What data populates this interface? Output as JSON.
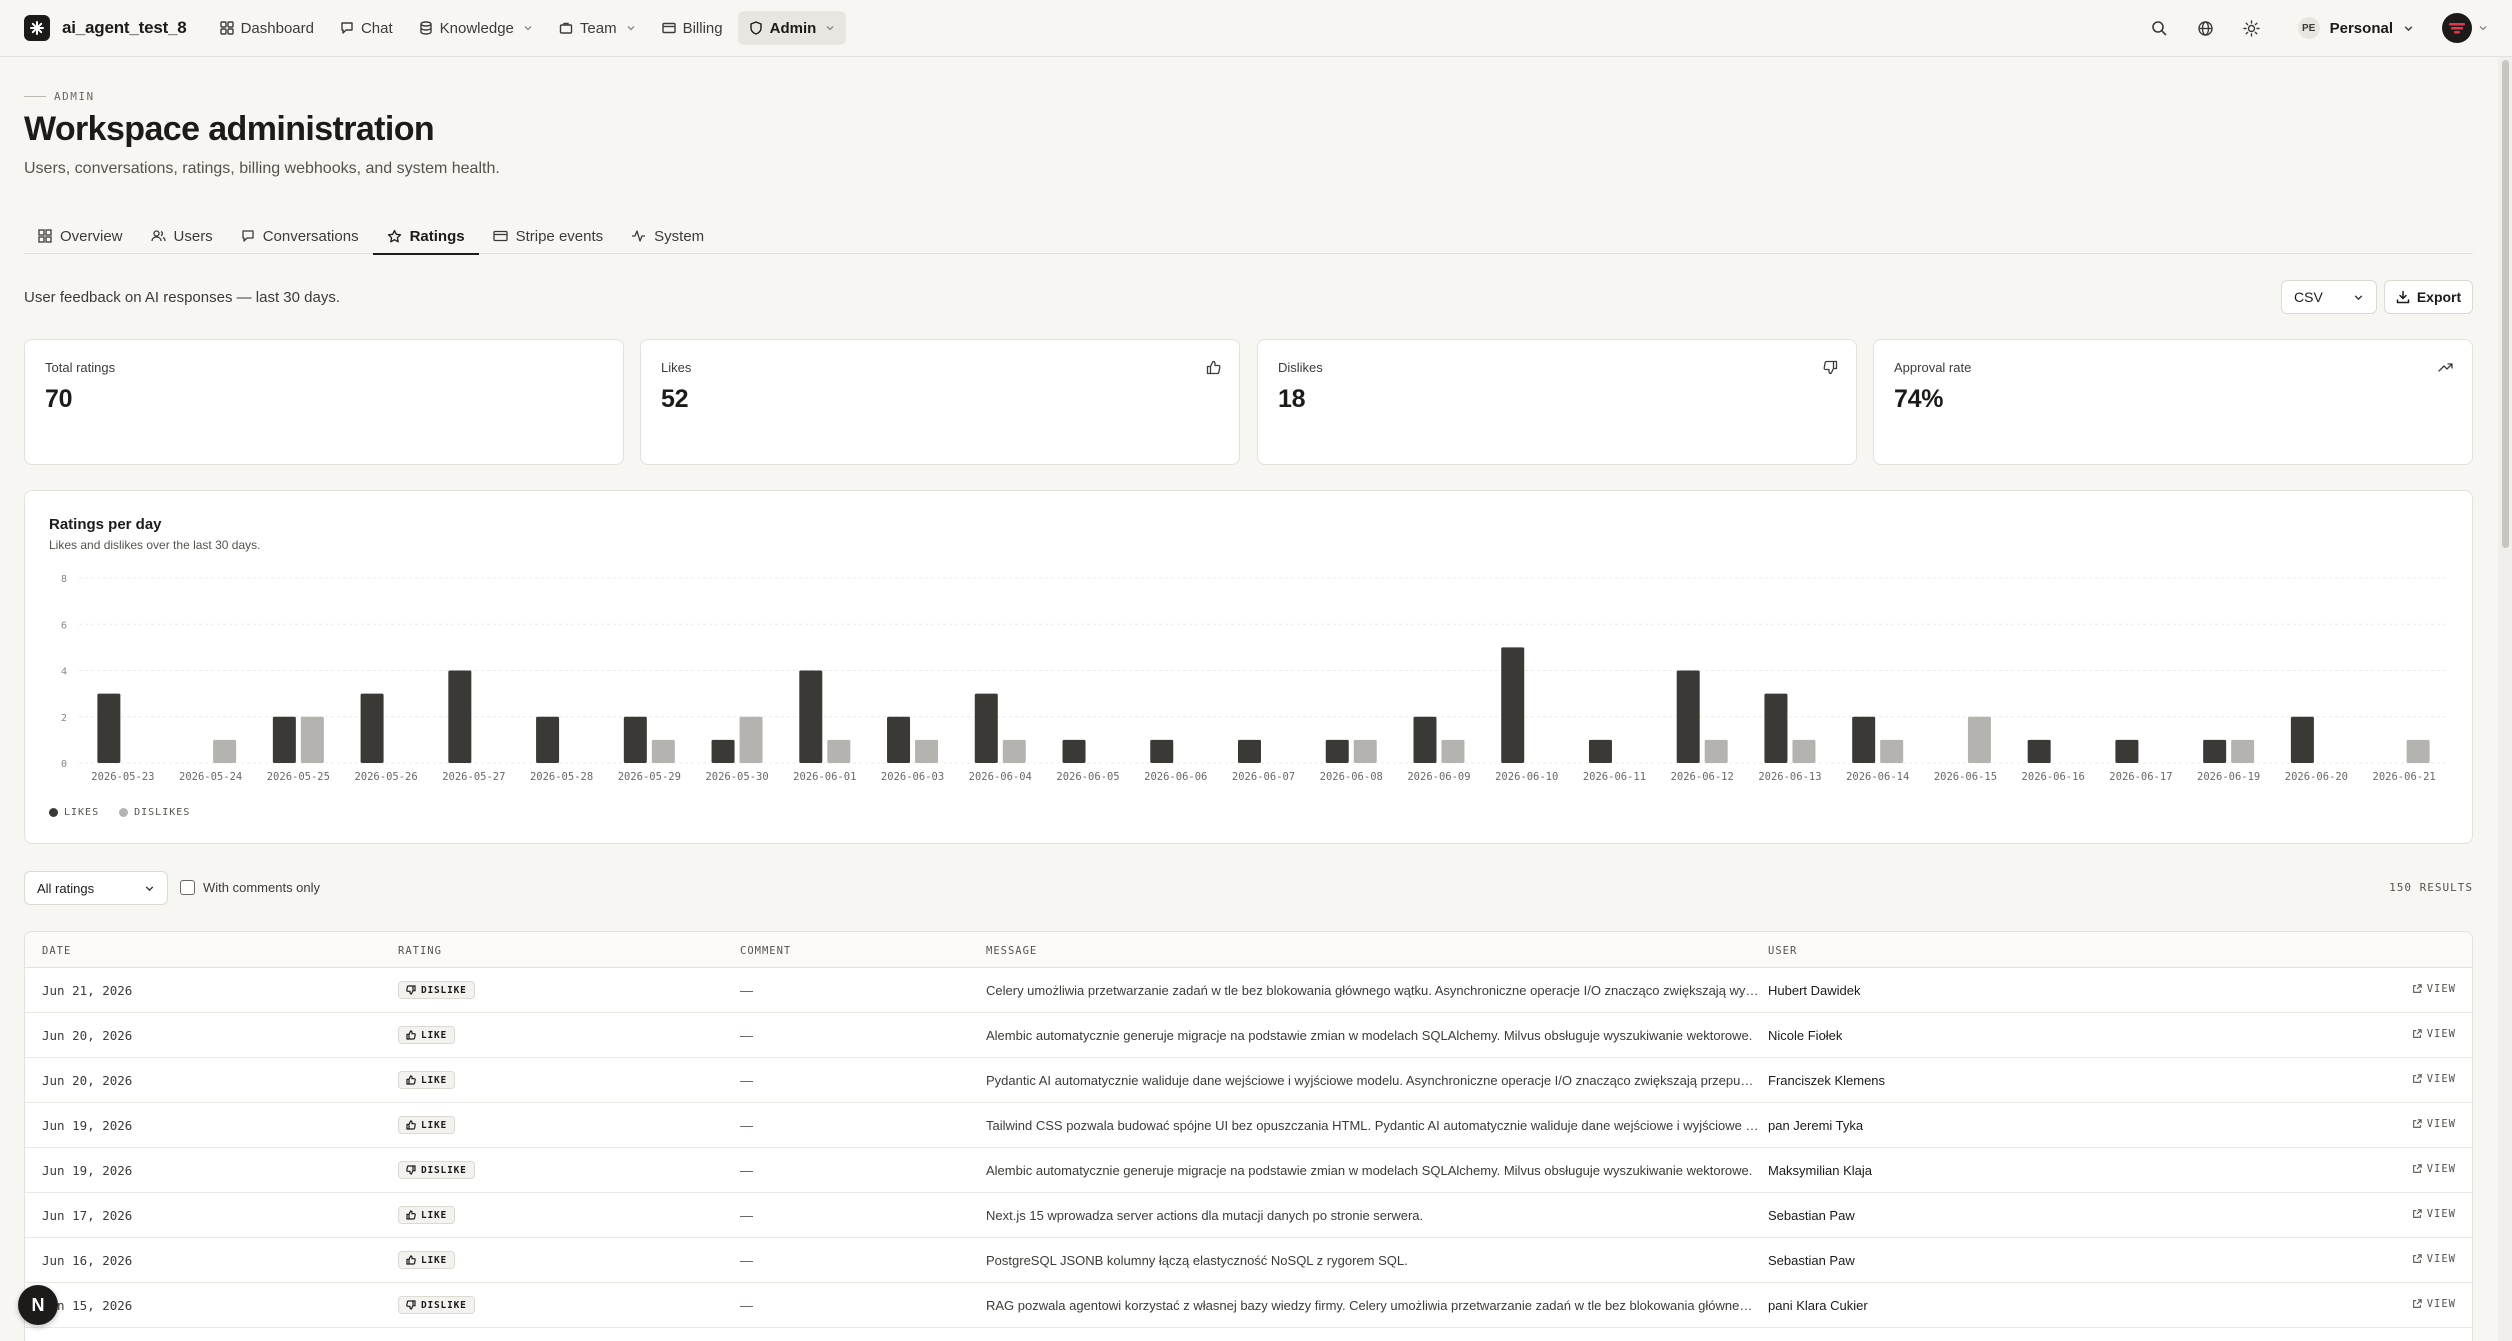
{
  "nav": {
    "brand": "ai_agent_test_8",
    "items": [
      {
        "label": "Dashboard",
        "icon": "dashboard-icon"
      },
      {
        "label": "Chat",
        "icon": "chat-icon"
      },
      {
        "label": "Knowledge",
        "icon": "database-icon"
      },
      {
        "label": "Team",
        "icon": "briefcase-icon"
      },
      {
        "label": "Billing",
        "icon": "credit-card-icon"
      },
      {
        "label": "Admin",
        "icon": "shield-icon"
      }
    ],
    "workspace_initials": "PE",
    "workspace_name": "Personal"
  },
  "header": {
    "eyebrow": "ADMIN",
    "title": "Workspace administration",
    "subtitle": "Users, conversations, ratings, billing webhooks, and system health."
  },
  "tabs": [
    {
      "label": "Overview",
      "icon": "grid-icon"
    },
    {
      "label": "Users",
      "icon": "users-icon"
    },
    {
      "label": "Conversations",
      "icon": "message-icon"
    },
    {
      "label": "Ratings",
      "icon": "star-icon"
    },
    {
      "label": "Stripe events",
      "icon": "card-icon"
    },
    {
      "label": "System",
      "icon": "activity-icon"
    }
  ],
  "section": {
    "description": "User feedback on AI responses — last 30 days.",
    "format_value": "CSV",
    "export_label": "Export"
  },
  "stats": [
    {
      "label": "Total ratings",
      "value": "70"
    },
    {
      "label": "Likes",
      "value": "52"
    },
    {
      "label": "Dislikes",
      "value": "18"
    },
    {
      "label": "Approval rate",
      "value": "74%"
    }
  ],
  "chart_data": {
    "type": "bar",
    "title": "Ratings per day",
    "subtitle": "Likes and dislikes over the last 30 days.",
    "ylim": [
      0,
      8
    ],
    "yticks": [
      0,
      2,
      4,
      6,
      8
    ],
    "grid": true,
    "legend_placement": "bottom-left",
    "categories": [
      "2026-05-23",
      "2026-05-24",
      "2026-05-25",
      "2026-05-26",
      "2026-05-27",
      "2026-05-28",
      "2026-05-29",
      "2026-05-30",
      "2026-06-01",
      "2026-06-03",
      "2026-06-04",
      "2026-06-05",
      "2026-06-06",
      "2026-06-07",
      "2026-06-08",
      "2026-06-09",
      "2026-06-10",
      "2026-06-11",
      "2026-06-12",
      "2026-06-13",
      "2026-06-14",
      "2026-06-15",
      "2026-06-16",
      "2026-06-17",
      "2026-06-19",
      "2026-06-20",
      "2026-06-21"
    ],
    "series": [
      {
        "name": "LIKES",
        "color": "#3a3936",
        "values": [
          3,
          0,
          2,
          3,
          4,
          2,
          2,
          1,
          4,
          2,
          3,
          1,
          1,
          1,
          1,
          2,
          5,
          1,
          4,
          3,
          2,
          0,
          1,
          1,
          1,
          2,
          0
        ]
      },
      {
        "name": "DISLIKES",
        "color": "#b4b3b0",
        "values": [
          0,
          1,
          2,
          0,
          0,
          0,
          1,
          2,
          1,
          1,
          1,
          0,
          0,
          0,
          1,
          1,
          0,
          0,
          1,
          1,
          1,
          2,
          0,
          0,
          1,
          0,
          1
        ]
      }
    ]
  },
  "filters": {
    "rating_select": "All ratings",
    "comments_only_label": "With comments only",
    "results": "150 RESULTS"
  },
  "table": {
    "columns": [
      "DATE",
      "RATING",
      "COMMENT",
      "MESSAGE",
      "USER"
    ],
    "view_label": "VIEW",
    "rows": [
      {
        "date": "Jun 21, 2026",
        "rating": "DISLIKE",
        "comment": "—",
        "message": "Celery umożliwia przetwarzanie zadań w tle bez blokowania głównego wątku. Asynchroniczne operacje I/O znacząco zwiększają wydajność aplikacji.",
        "user": "Hubert Dawidek"
      },
      {
        "date": "Jun 20, 2026",
        "rating": "LIKE",
        "comment": "—",
        "message": "Alembic automatycznie generuje migracje na podstawie zmian w modelach SQLAlchemy. Milvus obsługuje wyszukiwanie wektorowe.",
        "user": "Nicole Fiołek"
      },
      {
        "date": "Jun 20, 2026",
        "rating": "LIKE",
        "comment": "—",
        "message": "Pydantic AI automatycznie waliduje dane wejściowe i wyjściowe modelu. Asynchroniczne operacje I/O znacząco zwiększają przepustowość.",
        "user": "Franciszek Klemens"
      },
      {
        "date": "Jun 19, 2026",
        "rating": "LIKE",
        "comment": "—",
        "message": "Tailwind CSS pozwala budować spójne UI bez opuszczania HTML. Pydantic AI automatycznie waliduje dane wejściowe i wyjściowe modelu.",
        "user": "pan Jeremi Tyka"
      },
      {
        "date": "Jun 19, 2026",
        "rating": "DISLIKE",
        "comment": "—",
        "message": "Alembic automatycznie generuje migracje na podstawie zmian w modelach SQLAlchemy. Milvus obsługuje wyszukiwanie wektorowe.",
        "user": "Maksymilian Klaja"
      },
      {
        "date": "Jun 17, 2026",
        "rating": "LIKE",
        "comment": "—",
        "message": "Next.js 15 wprowadza server actions dla mutacji danych po stronie serwera.",
        "user": "Sebastian Paw"
      },
      {
        "date": "Jun 16, 2026",
        "rating": "LIKE",
        "comment": "—",
        "message": "PostgreSQL JSONB kolumny łączą elastyczność NoSQL z rygorem SQL.",
        "user": "Sebastian Paw"
      },
      {
        "date": "Jun 15, 2026",
        "rating": "DISLIKE",
        "comment": "—",
        "message": "RAG pozwala agentowi korzystać z własnej bazy wiedzy firmy. Celery umożliwia przetwarzanie zadań w tle bez blokowania głównego wątku.",
        "user": "pani Klara Cukier"
      }
    ]
  },
  "fab_label": "N"
}
